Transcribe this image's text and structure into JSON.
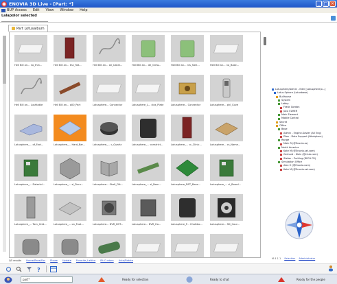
{
  "window": {
    "title": "ENOVIA 3D Live - [Part: *]"
  },
  "menu": [
    {
      "label": "BUP Access"
    },
    {
      "label": "Edit"
    },
    {
      "label": "View"
    },
    {
      "label": "Window"
    },
    {
      "label": "Help"
    }
  ],
  "path": {
    "label": "Lalapolor selected",
    "value": ""
  },
  "tab": {
    "label": "Part Lotusalbum"
  },
  "grid": {
    "items": [
      {
        "caption": "Hell Bill an... no_thin...",
        "shape": "block-white",
        "selected": false
      },
      {
        "caption": "Hell Bill an... tha_flat...",
        "shape": "tall-red",
        "selected": false
      },
      {
        "caption": "Hell Bill an... all_Cable...",
        "shape": "wire",
        "selected": false
      },
      {
        "caption": "Hell Bill an... de_Grew...",
        "shape": "block-green",
        "selected": false
      },
      {
        "caption": "Hell Bill an... nis_Slee...",
        "shape": "block-green",
        "selected": false
      },
      {
        "caption": "Hell Bill an... no_Base...",
        "shape": "block-white",
        "selected": false
      },
      {
        "caption": "",
        "shape": "none",
        "selected": false
      },
      {
        "caption": "Hell Bill an... Lushtable",
        "shape": "wire",
        "selected": false
      },
      {
        "caption": "Hell Bill an... o00_Part",
        "shape": "rod-brown",
        "selected": false
      },
      {
        "caption": "Lotusphere... Connector",
        "shape": "block-white",
        "selected": false
      },
      {
        "caption": "Lotusphere_L... clos_Plate",
        "shape": "block-white",
        "selected": false
      },
      {
        "caption": "Lotusphere... Connector",
        "shape": "gear-gold",
        "selected": false
      },
      {
        "caption": "Lotusphere... phl_Cove",
        "shape": "phone",
        "selected": false
      },
      {
        "caption": "",
        "shape": "none",
        "selected": false
      },
      {
        "caption": "Lotusphere_... of_Fact...",
        "shape": "bracket-blue",
        "selected": false
      },
      {
        "caption": "Lotusphere_... Hard_Bar...",
        "shape": "plate-blue",
        "selected": true
      },
      {
        "caption": "Lotusphere_... c_Quartz",
        "shape": "disc-dark",
        "selected": false
      },
      {
        "caption": "Lotusphere_... constrict...",
        "shape": "box-dark",
        "selected": false
      },
      {
        "caption": "Lotusphere_... cr_Clinic...",
        "shape": "tall-red",
        "selected": false
      },
      {
        "caption": "Lotusphere... cs_Name...",
        "shape": "plate-tan",
        "selected": false
      },
      {
        "caption": "",
        "shape": "none",
        "selected": false
      },
      {
        "caption": "Lotusphere_... Daterlol...",
        "shape": "board-green",
        "selected": false
      },
      {
        "caption": "Lotusphere_... sl_Dura...",
        "shape": "cube-grey",
        "selected": false
      },
      {
        "caption": "Lotusphere... Shell_Fitt...",
        "shape": "bracket-grey",
        "selected": false
      },
      {
        "caption": "Lotusphere_... sl_Nom...",
        "shape": "strip-green",
        "selected": false
      },
      {
        "caption": "Lotusphere_DST_Base...",
        "shape": "diamond-green",
        "selected": false
      },
      {
        "caption": "Lotusphere_... sl_Board...",
        "shape": "board-green",
        "selected": false
      },
      {
        "caption": "",
        "shape": "none",
        "selected": false
      },
      {
        "caption": "Lotusphere_... Torn_Grid...",
        "shape": "panel-grey",
        "selected": false
      },
      {
        "caption": "Lotusphere_... on_Foot...",
        "shape": "plate-grey",
        "selected": false
      },
      {
        "caption": "Lotusphere... DVR_DST...",
        "shape": "fan",
        "selected": false
      },
      {
        "caption": "Lotusphere... DVR_Ha...",
        "shape": "cube-dark",
        "selected": false
      },
      {
        "caption": "Lotusphere_F... Chalkbo...",
        "shape": "box-dark",
        "selected": false
      },
      {
        "caption": "Lotusphere... SD_Cour...",
        "shape": "speaker",
        "selected": false
      },
      {
        "caption": "",
        "shape": "none",
        "selected": false
      },
      {
        "caption": "",
        "shape": "cyl-grey",
        "selected": false
      },
      {
        "caption": "",
        "shape": "cyl-grey",
        "selected": false
      },
      {
        "caption": "",
        "shape": "cyl-green",
        "selected": false
      },
      {
        "caption": "",
        "shape": "block-white",
        "selected": false
      },
      {
        "caption": "",
        "shape": "block-white",
        "selected": false
      },
      {
        "caption": "",
        "shape": "block-white",
        "selected": false
      }
    ]
  },
  "footer_links": {
    "label": "Q5 results",
    "links": [
      "Home/Base/Fav",
      "Phase",
      "Update",
      "Favorite_Lattice",
      "Pit Custom",
      "Auto/Rotate"
    ]
  },
  "tree": {
    "items": [
      {
        "label": "Lotusphere/Admin - Eder [Lotusphere/o...]",
        "indent": 0,
        "color": "#2e6bd1"
      },
      {
        "label": "Lotus Sphere (Lotusbase)",
        "indent": 1,
        "color": "#2e6bd1"
      },
      {
        "label": "Bullhouse",
        "indent": 2,
        "color": "#e0a020"
      },
      {
        "label": "System",
        "indent": 3,
        "color": "#4a9a3a"
      },
      {
        "label": "Lobby",
        "indent": 3,
        "color": "#4a9a3a"
      },
      {
        "label": "Frank Gordon",
        "indent": 4,
        "color": "#c44"
      },
      {
        "label": "Jaco ELMER",
        "indent": 4,
        "color": "#c44"
      },
      {
        "label": "Main Element",
        "indent": 3,
        "color": "#4a9a3a"
      },
      {
        "label": "Mobile Control",
        "indent": 3,
        "color": "#4a9a3a"
      },
      {
        "label": "Secret",
        "indent": 2,
        "color": "#e0a020"
      },
      {
        "label": "Office",
        "indent": 2,
        "color": "#e0a020"
      },
      {
        "label": "Base",
        "indent": 3,
        "color": "#4a9a3a"
      },
      {
        "label": "Admin - Engine-Saster (All Eng)",
        "indent": 4,
        "color": "#c44"
      },
      {
        "label": "Piles - Data Support (Workplace)",
        "indent": 4,
        "color": "#c44"
      },
      {
        "label": "Range",
        "indent": 3,
        "color": "#4a9a3a"
      },
      {
        "label": "Main R (@Enovia.ro)",
        "indent": 4,
        "color": "#c44"
      },
      {
        "label": "North America",
        "indent": 3,
        "color": "#4a9a3a"
      },
      {
        "label": "Kate M (@Enovia.sel.com)",
        "indent": 4,
        "color": "#c44"
      },
      {
        "label": "Gerhard - Klein (@nlub.com)",
        "indent": 4,
        "color": "#c44"
      },
      {
        "label": "Stefan - Purtling (RECA FR)",
        "indent": 4,
        "color": "#c44"
      },
      {
        "label": "Simulation Office",
        "indent": 3,
        "color": "#4a9a3a"
      },
      {
        "label": "Alex O (@Enovia.com)",
        "indent": 4,
        "color": "#c44"
      },
      {
        "label": "Kate M (@Enovia.sel.com)",
        "indent": 4,
        "color": "#c44"
      }
    ]
  },
  "right_footer": {
    "label": "M 4 1-1",
    "links": [
      "Selection",
      "Administrator"
    ]
  },
  "status": {
    "part_field": "part*",
    "msg1": "Ready for selection",
    "msg2": "Ready to chat",
    "msg3": "Ready for the people"
  },
  "colors": {
    "titlebar": "#1f56c8",
    "selection": "#f38b1f",
    "link": "#2a4fc8"
  },
  "icons": [
    "app-logo-icon",
    "minimize-icon",
    "maximize-icon",
    "close-icon",
    "part-tab-icon",
    "compass-icon",
    "refresh-icon",
    "zoom-icon",
    "help-icon",
    "layout-icon"
  ]
}
